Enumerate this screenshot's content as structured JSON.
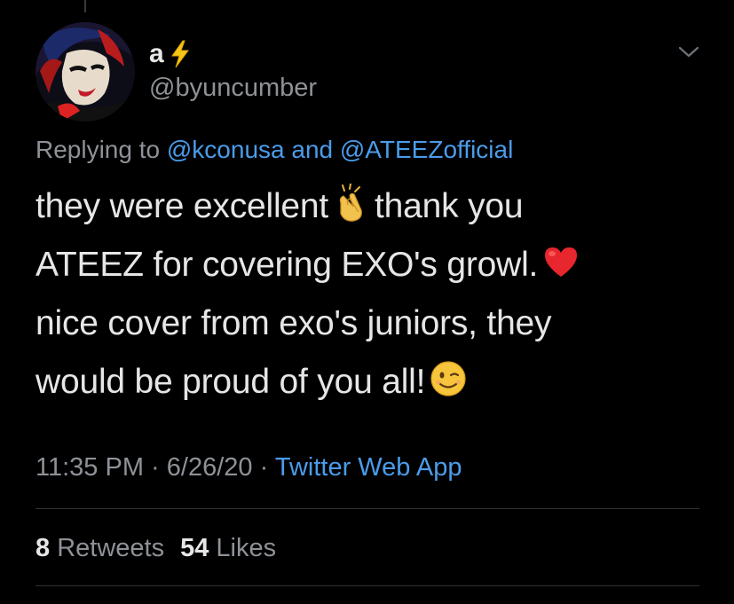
{
  "tweet": {
    "author": {
      "display_name": "a",
      "handle": "@byuncumber",
      "name_emoji": "lightning-bolt"
    },
    "reply": {
      "prefix": "Replying to",
      "mention_1": "@kconusa",
      "conjunction": "and",
      "mention_2": "@ATEEZofficial"
    },
    "body": {
      "line_1a": "they were excellent",
      "line_1b": "thank you",
      "line_2": "ATEEZ for covering EXO's growl.",
      "line_3": "nice cover from exo's juniors, they",
      "line_4": "would be proud of you all!",
      "emojis": [
        "clapping-hands",
        "red-heart",
        "winking-face"
      ]
    },
    "meta": {
      "time": "11:35 PM",
      "separator": "·",
      "date": "6/26/20",
      "source": "Twitter Web App"
    },
    "stats": {
      "retweets_count": "8",
      "retweets_label": "Retweets",
      "likes_count": "54",
      "likes_label": "Likes"
    }
  },
  "colors": {
    "background": "#000000",
    "text_primary": "#e6e6e6",
    "text_secondary": "#8e9297",
    "link": "#4a9cea",
    "divider": "#2f3336"
  }
}
